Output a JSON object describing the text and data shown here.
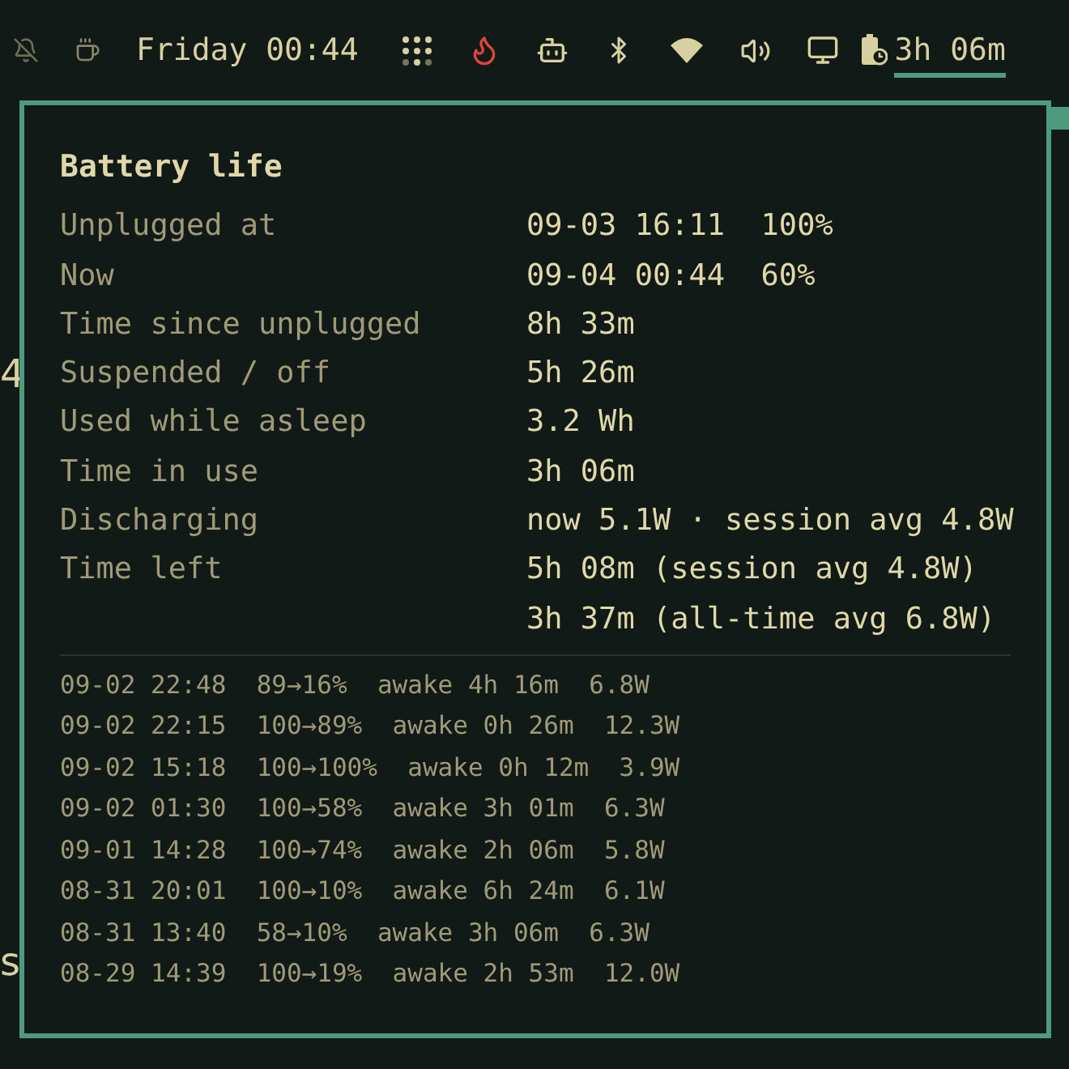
{
  "top_bar": {
    "clock": "Friday 00:44",
    "battery_time": "3h 06m"
  },
  "background_text": [
    "4",
    "s"
  ],
  "popup": {
    "title": "Battery life",
    "stats": [
      {
        "label": "Unplugged at",
        "value": "09-03 16:11  100%"
      },
      {
        "label": "Now",
        "value": "09-04 00:44  60%"
      },
      {
        "label": "Time since unplugged",
        "value": "8h 33m"
      },
      {
        "label": "Suspended / off",
        "value": "5h 26m"
      },
      {
        "label": "Used while asleep",
        "value": "3.2 Wh"
      },
      {
        "label": "Time in use",
        "value": "3h 06m"
      },
      {
        "label": "Discharging",
        "value": "now 5.1W · session avg 4.8W"
      },
      {
        "label": "Time left",
        "value": "5h 08m (session avg 4.8W)"
      },
      {
        "value": "3h 37m (all-time avg 6.8W)"
      }
    ],
    "history": [
      "09-02 22:48  89→16%  awake 4h 16m  6.8W",
      "09-02 22:15  100→89%  awake 0h 26m  12.3W",
      "09-02 15:18  100→100%  awake 0h 12m  3.9W",
      "09-02 01:30  100→58%  awake 3h 01m  6.3W",
      "09-01 14:28  100→74%  awake 2h 06m  5.8W",
      "08-31 20:01  100→10%  awake 6h 24m  6.1W",
      "08-31 13:40  58→10%  awake 3h 06m  6.3W",
      "08-29 14:39  100→19%  awake 2h 53m  12.0W"
    ]
  }
}
